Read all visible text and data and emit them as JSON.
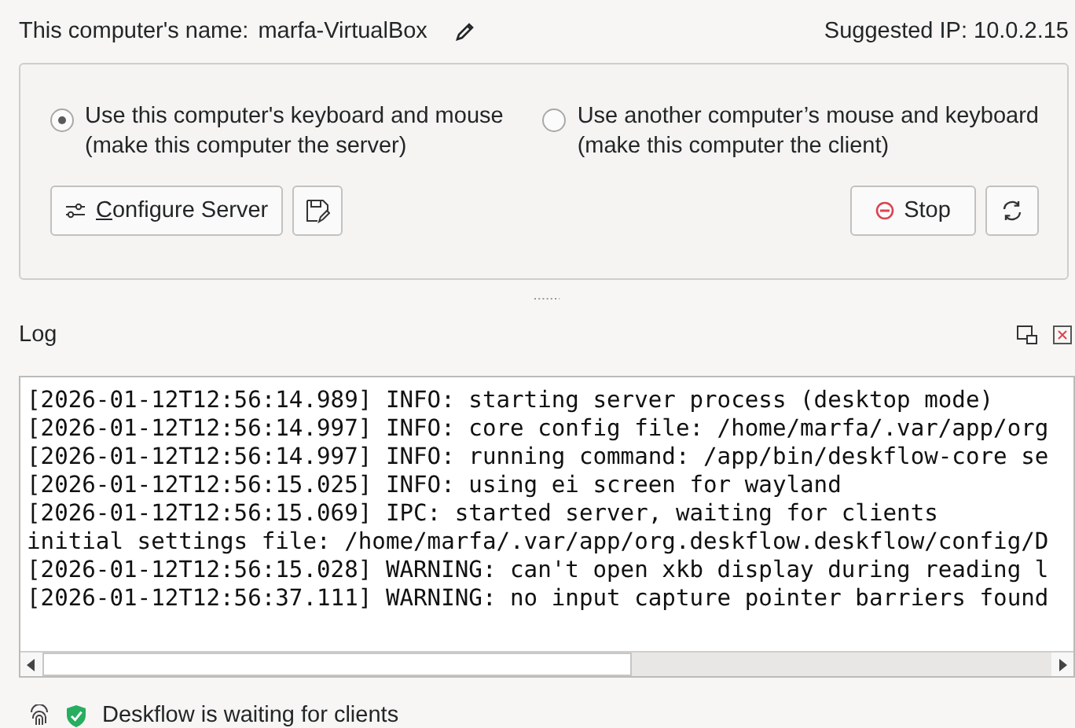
{
  "computer_name": {
    "label": "This computer's name:",
    "value": "marfa-VirtualBox"
  },
  "suggested_ip": "Suggested IP: 10.0.2.15",
  "modes": [
    {
      "line1": "Use this computer's keyboard and mouse",
      "line2": "(make this computer the server)",
      "selected": true
    },
    {
      "line1": "Use another computer’s mouse and keyboard",
      "line2": "(make this computer the client)",
      "selected": false
    }
  ],
  "configure_button": "Configure Server",
  "stop_button": "Stop",
  "log": {
    "title": "Log",
    "lines": [
      "[2026-01-12T12:56:14.989] INFO: starting server process (desktop mode)",
      "[2026-01-12T12:56:14.997] INFO: core config file: /home/marfa/.var/app/org",
      "[2026-01-12T12:56:14.997] INFO: running command: /app/bin/deskflow-core se",
      "[2026-01-12T12:56:15.025] INFO: using ei screen for wayland",
      "[2026-01-12T12:56:15.069] IPC: started server, waiting for clients",
      "initial settings file: /home/marfa/.var/app/org.deskflow.deskflow/config/D",
      "[2026-01-12T12:56:15.028] WARNING: can't open xkb display during reading l",
      "[2026-01-12T12:56:37.111] WARNING: no input capture pointer barriers found"
    ]
  },
  "status": "Deskflow is waiting for clients"
}
